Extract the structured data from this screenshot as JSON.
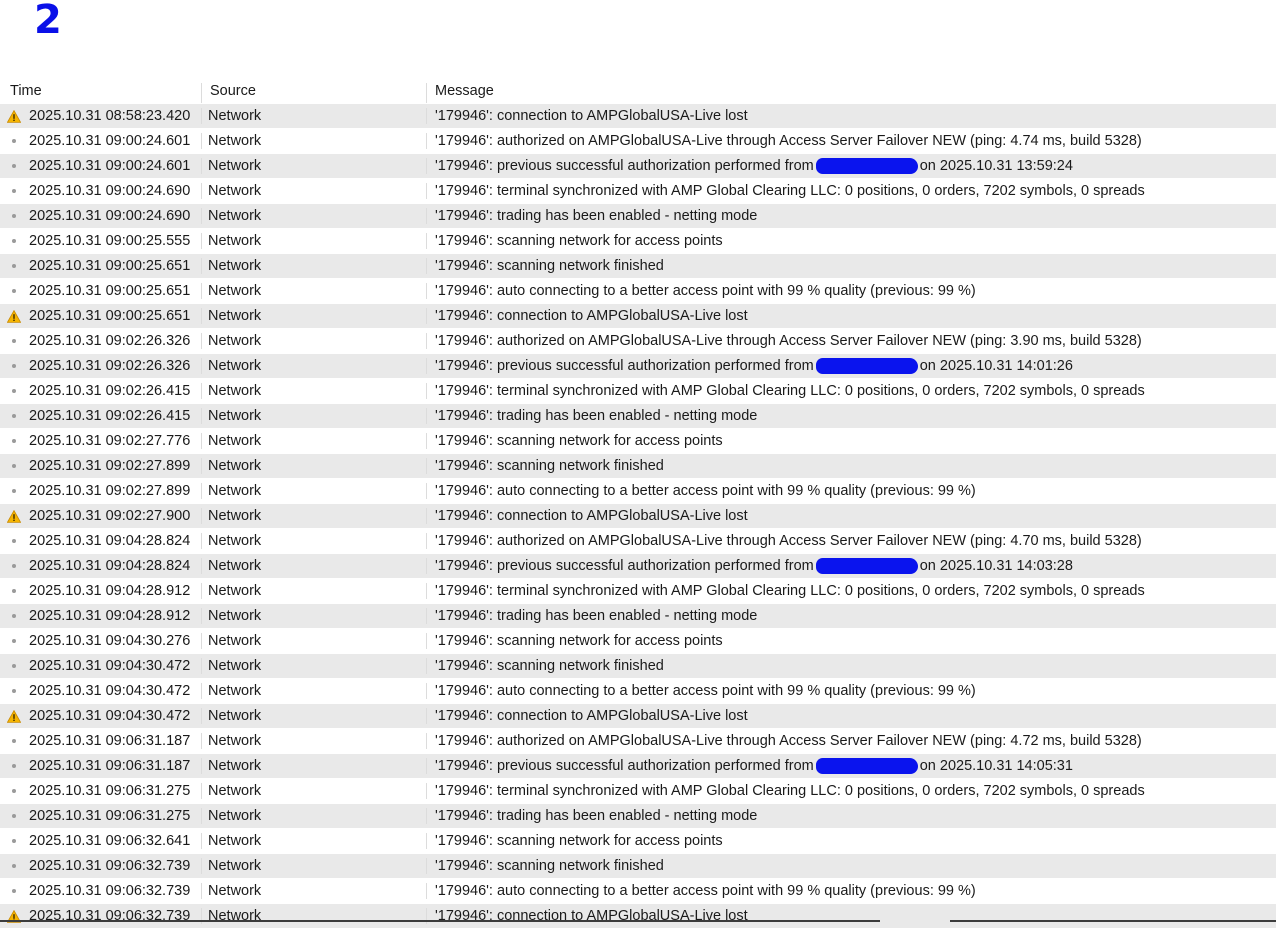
{
  "marker_label": "2",
  "columns": {
    "time": "Time",
    "source": "Source",
    "message": "Message"
  },
  "rows": [
    {
      "level": "warning",
      "time": "2025.10.31 08:58:23.420",
      "source": "Network",
      "message": "'179946': connection to AMPGlobalUSA-Live lost"
    },
    {
      "level": "info",
      "time": "2025.10.31 09:00:24.601",
      "source": "Network",
      "message": "'179946': authorized on AMPGlobalUSA-Live through Access Server Failover NEW (ping: 4.74 ms, build 5328)"
    },
    {
      "level": "info",
      "time": "2025.10.31 09:00:24.601",
      "source": "Network",
      "message": "'179946': previous successful authorization performed from",
      "redacted": true,
      "message_after": "on 2025.10.31 13:59:24"
    },
    {
      "level": "info",
      "time": "2025.10.31 09:00:24.690",
      "source": "Network",
      "message": "'179946': terminal synchronized with AMP Global Clearing LLC: 0 positions, 0 orders, 7202 symbols, 0 spreads"
    },
    {
      "level": "info",
      "time": "2025.10.31 09:00:24.690",
      "source": "Network",
      "message": "'179946': trading has been enabled - netting mode"
    },
    {
      "level": "info",
      "time": "2025.10.31 09:00:25.555",
      "source": "Network",
      "message": "'179946': scanning network for access points"
    },
    {
      "level": "info",
      "time": "2025.10.31 09:00:25.651",
      "source": "Network",
      "message": "'179946': scanning network finished"
    },
    {
      "level": "info",
      "time": "2025.10.31 09:00:25.651",
      "source": "Network",
      "message": "'179946': auto connecting to a better access point with 99 % quality (previous: 99 %)"
    },
    {
      "level": "warning",
      "time": "2025.10.31 09:00:25.651",
      "source": "Network",
      "message": "'179946': connection to AMPGlobalUSA-Live lost"
    },
    {
      "level": "info",
      "time": "2025.10.31 09:02:26.326",
      "source": "Network",
      "message": "'179946': authorized on AMPGlobalUSA-Live through Access Server Failover NEW (ping: 3.90 ms, build 5328)"
    },
    {
      "level": "info",
      "time": "2025.10.31 09:02:26.326",
      "source": "Network",
      "message": "'179946': previous successful authorization performed from",
      "redacted": true,
      "message_after": "on 2025.10.31 14:01:26"
    },
    {
      "level": "info",
      "time": "2025.10.31 09:02:26.415",
      "source": "Network",
      "message": "'179946': terminal synchronized with AMP Global Clearing LLC: 0 positions, 0 orders, 7202 symbols, 0 spreads"
    },
    {
      "level": "info",
      "time": "2025.10.31 09:02:26.415",
      "source": "Network",
      "message": "'179946': trading has been enabled - netting mode"
    },
    {
      "level": "info",
      "time": "2025.10.31 09:02:27.776",
      "source": "Network",
      "message": "'179946': scanning network for access points"
    },
    {
      "level": "info",
      "time": "2025.10.31 09:02:27.899",
      "source": "Network",
      "message": "'179946': scanning network finished"
    },
    {
      "level": "info",
      "time": "2025.10.31 09:02:27.899",
      "source": "Network",
      "message": "'179946': auto connecting to a better access point with 99 % quality (previous: 99 %)"
    },
    {
      "level": "warning",
      "time": "2025.10.31 09:02:27.900",
      "source": "Network",
      "message": "'179946': connection to AMPGlobalUSA-Live lost"
    },
    {
      "level": "info",
      "time": "2025.10.31 09:04:28.824",
      "source": "Network",
      "message": "'179946': authorized on AMPGlobalUSA-Live through Access Server Failover NEW (ping: 4.70 ms, build 5328)"
    },
    {
      "level": "info",
      "time": "2025.10.31 09:04:28.824",
      "source": "Network",
      "message": "'179946': previous successful authorization performed from",
      "redacted": true,
      "message_after": "on 2025.10.31 14:03:28"
    },
    {
      "level": "info",
      "time": "2025.10.31 09:04:28.912",
      "source": "Network",
      "message": "'179946': terminal synchronized with AMP Global Clearing LLC: 0 positions, 0 orders, 7202 symbols, 0 spreads"
    },
    {
      "level": "info",
      "time": "2025.10.31 09:04:28.912",
      "source": "Network",
      "message": "'179946': trading has been enabled - netting mode"
    },
    {
      "level": "info",
      "time": "2025.10.31 09:04:30.276",
      "source": "Network",
      "message": "'179946': scanning network for access points"
    },
    {
      "level": "info",
      "time": "2025.10.31 09:04:30.472",
      "source": "Network",
      "message": "'179946': scanning network finished"
    },
    {
      "level": "info",
      "time": "2025.10.31 09:04:30.472",
      "source": "Network",
      "message": "'179946': auto connecting to a better access point with 99 % quality (previous: 99 %)"
    },
    {
      "level": "warning",
      "time": "2025.10.31 09:04:30.472",
      "source": "Network",
      "message": "'179946': connection to AMPGlobalUSA-Live lost"
    },
    {
      "level": "info",
      "time": "2025.10.31 09:06:31.187",
      "source": "Network",
      "message": "'179946': authorized on AMPGlobalUSA-Live through Access Server Failover NEW (ping: 4.72 ms, build 5328)"
    },
    {
      "level": "info",
      "time": "2025.10.31 09:06:31.187",
      "source": "Network",
      "message": "'179946': previous successful authorization performed from",
      "redacted": true,
      "message_after": "on 2025.10.31 14:05:31"
    },
    {
      "level": "info",
      "time": "2025.10.31 09:06:31.275",
      "source": "Network",
      "message": "'179946': terminal synchronized with AMP Global Clearing LLC: 0 positions, 0 orders, 7202 symbols, 0 spreads"
    },
    {
      "level": "info",
      "time": "2025.10.31 09:06:31.275",
      "source": "Network",
      "message": "'179946': trading has been enabled - netting mode"
    },
    {
      "level": "info",
      "time": "2025.10.31 09:06:32.641",
      "source": "Network",
      "message": "'179946': scanning network for access points"
    },
    {
      "level": "info",
      "time": "2025.10.31 09:06:32.739",
      "source": "Network",
      "message": "'179946': scanning network finished"
    },
    {
      "level": "info",
      "time": "2025.10.31 09:06:32.739",
      "source": "Network",
      "message": "'179946': auto connecting to a better access point with 99 % quality (previous: 99 %)"
    },
    {
      "level": "warning",
      "time": "2025.10.31 09:06:32.739",
      "source": "Network",
      "message": "'179946': connection to AMPGlobalUSA-Live lost"
    }
  ],
  "colors": {
    "warning": "#f5b400",
    "info_dot": "#9a9a9a",
    "redaction": "#0a14ee",
    "stripe": "#e9e9e9"
  },
  "icons": {
    "warning": "warning-icon",
    "info": "info-dot-icon"
  }
}
